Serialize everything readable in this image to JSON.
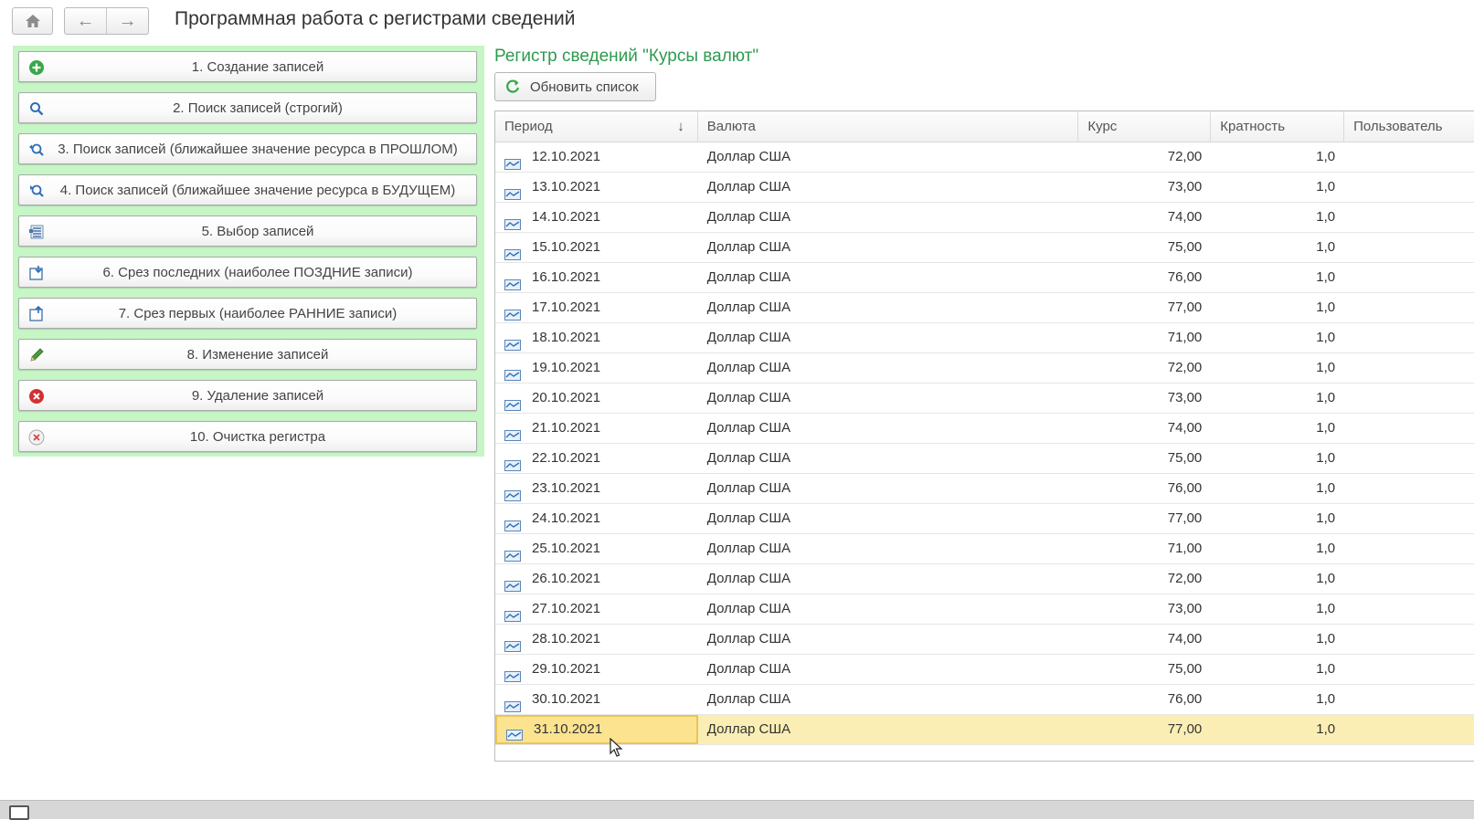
{
  "page_title": "Программная работа с регистрами сведений",
  "commands": [
    {
      "label": "1. Создание записей",
      "icon": "add-circle-icon"
    },
    {
      "label": "2. Поиск записей (строгий)",
      "icon": "search-icon"
    },
    {
      "label": "3. Поиск записей (ближайшее значение ресурса в ПРОШЛОМ)",
      "icon": "search-back-icon"
    },
    {
      "label": "4. Поиск записей (ближайшее значение ресурса в БУДУЩЕМ)",
      "icon": "search-forward-icon"
    },
    {
      "label": "5. Выбор записей",
      "icon": "list-select-icon"
    },
    {
      "label": "6. Срез последних (наиболее ПОЗДНИЕ записи)",
      "icon": "slice-last-icon"
    },
    {
      "label": "7. Срез первых (наиболее РАННИЕ записи)",
      "icon": "slice-first-icon"
    },
    {
      "label": "8. Изменение записей",
      "icon": "pencil-icon"
    },
    {
      "label": "9. Удаление записей",
      "icon": "delete-red-icon"
    },
    {
      "label": "10. Очистка регистра",
      "icon": "clear-icon"
    }
  ],
  "register": {
    "title": "Регистр сведений \"Курсы валют\"",
    "refresh_label": "Обновить список",
    "columns": [
      "Период",
      "Валюта",
      "Курс",
      "Кратность",
      "Пользователь"
    ],
    "rows": [
      {
        "period": "12.10.2021",
        "currency": "Доллар США",
        "rate": "72,00",
        "mult": "1,0"
      },
      {
        "period": "13.10.2021",
        "currency": "Доллар США",
        "rate": "73,00",
        "mult": "1,0"
      },
      {
        "period": "14.10.2021",
        "currency": "Доллар США",
        "rate": "74,00",
        "mult": "1,0"
      },
      {
        "period": "15.10.2021",
        "currency": "Доллар США",
        "rate": "75,00",
        "mult": "1,0"
      },
      {
        "period": "16.10.2021",
        "currency": "Доллар США",
        "rate": "76,00",
        "mult": "1,0"
      },
      {
        "period": "17.10.2021",
        "currency": "Доллар США",
        "rate": "77,00",
        "mult": "1,0"
      },
      {
        "period": "18.10.2021",
        "currency": "Доллар США",
        "rate": "71,00",
        "mult": "1,0"
      },
      {
        "period": "19.10.2021",
        "currency": "Доллар США",
        "rate": "72,00",
        "mult": "1,0"
      },
      {
        "period": "20.10.2021",
        "currency": "Доллар США",
        "rate": "73,00",
        "mult": "1,0"
      },
      {
        "period": "21.10.2021",
        "currency": "Доллар США",
        "rate": "74,00",
        "mult": "1,0"
      },
      {
        "period": "22.10.2021",
        "currency": "Доллар США",
        "rate": "75,00",
        "mult": "1,0"
      },
      {
        "period": "23.10.2021",
        "currency": "Доллар США",
        "rate": "76,00",
        "mult": "1,0"
      },
      {
        "period": "24.10.2021",
        "currency": "Доллар США",
        "rate": "77,00",
        "mult": "1,0"
      },
      {
        "period": "25.10.2021",
        "currency": "Доллар США",
        "rate": "71,00",
        "mult": "1,0"
      },
      {
        "period": "26.10.2021",
        "currency": "Доллар США",
        "rate": "72,00",
        "mult": "1,0"
      },
      {
        "period": "27.10.2021",
        "currency": "Доллар США",
        "rate": "73,00",
        "mult": "1,0"
      },
      {
        "period": "28.10.2021",
        "currency": "Доллар США",
        "rate": "74,00",
        "mult": "1,0"
      },
      {
        "period": "29.10.2021",
        "currency": "Доллар США",
        "rate": "75,00",
        "mult": "1,0"
      },
      {
        "period": "30.10.2021",
        "currency": "Доллар США",
        "rate": "76,00",
        "mult": "1,0"
      },
      {
        "period": "31.10.2021",
        "currency": "Доллар США",
        "rate": "77,00",
        "mult": "1,0"
      }
    ],
    "selected_row": 19
  },
  "colors": {
    "command_panel_bg": "#c6f5c6",
    "section_title": "#2e9a4f",
    "selected_row": "#fbeeb4"
  }
}
